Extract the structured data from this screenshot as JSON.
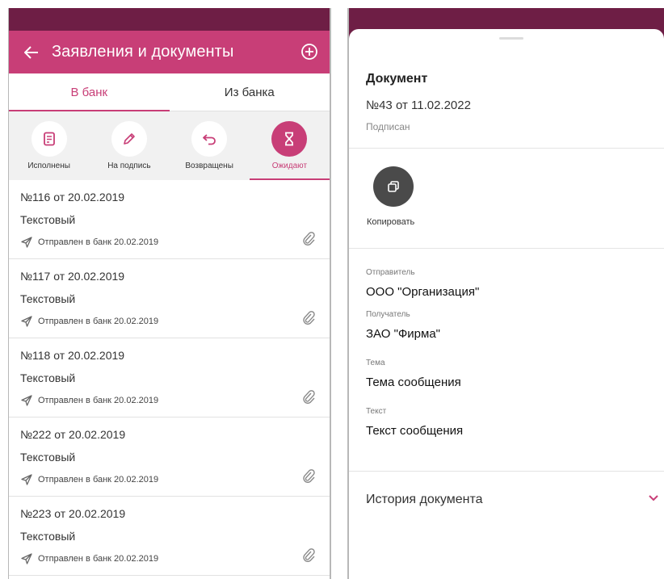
{
  "left": {
    "header": {
      "title": "Заявления и документы"
    },
    "tabs": [
      {
        "label": "В банк",
        "active": true
      },
      {
        "label": "Из банка",
        "active": false
      }
    ],
    "filters": [
      {
        "label": "Исполнены",
        "icon": "document-icon",
        "active": false
      },
      {
        "label": "На подпись",
        "icon": "pen-icon",
        "active": false
      },
      {
        "label": "Возвращены",
        "icon": "return-arrow-icon",
        "active": false
      },
      {
        "label": "Ожидают",
        "icon": "hourglass-icon",
        "active": true
      }
    ],
    "documents": [
      {
        "number": "№116 от 20.02.2019",
        "type": "Текстовый",
        "status": "Отправлен в банк 20.02.2019"
      },
      {
        "number": "№117 от 20.02.2019",
        "type": "Текстовый",
        "status": "Отправлен в банк 20.02.2019"
      },
      {
        "number": "№118 от 20.02.2019",
        "type": "Текстовый",
        "status": "Отправлен в банк 20.02.2019"
      },
      {
        "number": "№222 от 20.02.2019",
        "type": "Текстовый",
        "status": "Отправлен в банк 20.02.2019"
      },
      {
        "number": "№223 от 20.02.2019",
        "type": "Текстовый",
        "status": "Отправлен в банк 20.02.2019"
      }
    ]
  },
  "right": {
    "title": "Документ",
    "number": "№43 от 11.02.2022",
    "state": "Подписан",
    "copy_label": "Копировать",
    "fields": [
      {
        "label": "Отправитель",
        "value": "ООО \"Организация\""
      },
      {
        "label": "Получатель",
        "value": "ЗАО \"Фирма\""
      },
      {
        "label": "Тема",
        "value": "Тема сообщения"
      },
      {
        "label": "Текст",
        "value": "Текст сообщения"
      }
    ],
    "history_label": "История документа"
  },
  "colors": {
    "accent": "#c83e77",
    "status_bar": "#6e1e45"
  }
}
